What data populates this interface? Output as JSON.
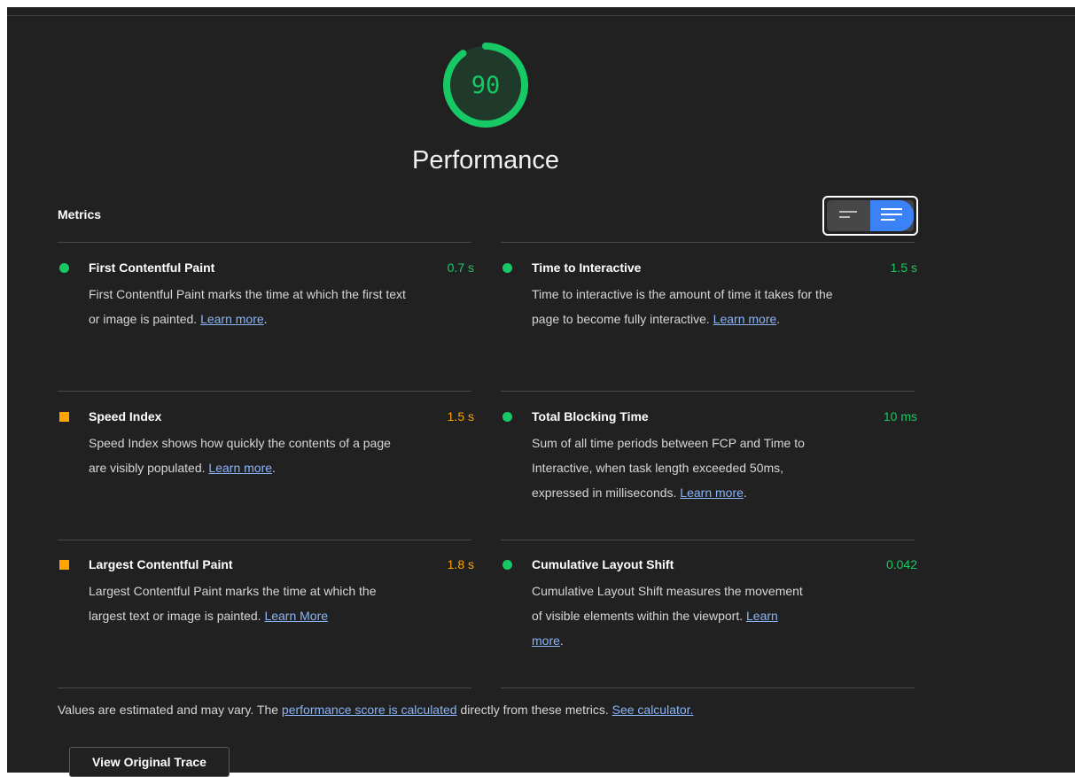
{
  "score": {
    "value": "90",
    "fraction": 0.9,
    "title": "Performance",
    "color": "#17c964"
  },
  "metrics_heading": "Metrics",
  "view_toggle": {
    "selected": "expanded"
  },
  "metrics": [
    {
      "name": "First Contentful Paint",
      "value": "0.7 s",
      "status": "pass",
      "desc_before": "First Contentful Paint marks the time at which the first text or image is painted. ",
      "link": "Learn more",
      "desc_after": "."
    },
    {
      "name": "Time to Interactive",
      "value": "1.5 s",
      "status": "pass",
      "desc_before": "Time to interactive is the amount of time it takes for the page to become fully interactive. ",
      "link": "Learn more",
      "desc_after": "."
    },
    {
      "name": "Speed Index",
      "value": "1.5 s",
      "status": "average",
      "desc_before": "Speed Index shows how quickly the contents of a page are visibly populated. ",
      "link": "Learn more",
      "desc_after": "."
    },
    {
      "name": "Total Blocking Time",
      "value": "10 ms",
      "status": "pass",
      "desc_before": "Sum of all time periods between FCP and Time to Interactive, when task length exceeded 50ms, expressed in milliseconds. ",
      "link": "Learn more",
      "desc_after": "."
    },
    {
      "name": "Largest Contentful Paint",
      "value": "1.8 s",
      "status": "average",
      "desc_before": "Largest Contentful Paint marks the time at which the largest text or image is painted. ",
      "link": "Learn More",
      "desc_after": ""
    },
    {
      "name": "Cumulative Layout Shift",
      "value": "0.042",
      "status": "pass",
      "desc_before": "Cumulative Layout Shift measures the movement of visible elements within the viewport. ",
      "link": "Learn more",
      "desc_after": "."
    }
  ],
  "footer": {
    "text1": "Values are estimated and may vary. The ",
    "link1": "performance score is calculated",
    "text2": " directly from these metrics. ",
    "link2": "See calculator."
  },
  "trace_button": "View Original Trace",
  "colors": {
    "pass": "#17c964",
    "average": "#ffa400",
    "link": "#8ab4f8",
    "toggle_active": "#3b82f6"
  }
}
